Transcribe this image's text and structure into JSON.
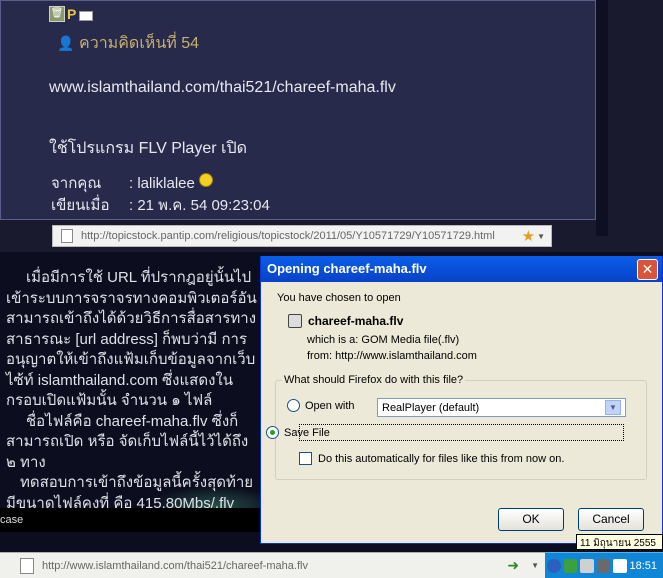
{
  "post": {
    "comment_label": "ความคิดเห็นที่ 54",
    "url": "www.islamthailand.com/thai521/chareef-maha.flv",
    "instruction": "ใช้โปรแกรม FLV Player เปิด",
    "from_key": "จากคุณ",
    "from_value": ": laliklalee",
    "date_key": "เขียนเมื่อ",
    "date_value": ": 21 พ.ค. 54 09:23:04"
  },
  "linkbar": {
    "url": "http://topicstock.pantip.com/religious/topicstock/2011/05/Y10571729/Y10571729.html"
  },
  "lower_text": {
    "paragraph1": "เมื่อมีการใช้ URL ที่ปรากฎอยู่นั้นไปเข้าระบบการจราจรทางคอมพิวเตอร์อันสามารถเข้าถึงได้ด้วยวิธีการสื่อสารทางสาธารณะ [url address] ก็พบว่ามี การอนุญาตให้เข้าถึงแฟ้มเก็บข้อมูลจากเว็บไซ้ท์ islamthailand.com ซึ่งแสดงในกรอบเปิดแฟ้มนั้น จำนวน ๑ ไฟล์",
    "paragraph2": "ชื่อไฟล์คือ chareef-maha.flv ซึ่งก็สามารถเปิด หรือ จัดเก็บไฟล์นี้ไว้ได้ถึง ๒ ทาง",
    "paragraph3": "ทดสอบการเข้าถึงข้อมูลนี้ครั้งสุดท้ายมีขนาดไฟล์คงที่ คือ 415.80Mbs/.flv",
    "video_caption": "case"
  },
  "dialog": {
    "title": "Opening chareef-maha.flv",
    "chosen_text": "You have chosen to open",
    "filename": "chareef-maha.flv",
    "which_is": "which is a:  GOM Media file(.flv)",
    "from": "from:  http://www.islamthailand.com",
    "question": "What should Firefox do with this file?",
    "open_with_label": "Open with",
    "open_with_value": "RealPlayer (default)",
    "save_label": "Save File",
    "auto_label": "Do this automatically for files like this from now on.",
    "ok_label": "OK",
    "cancel_label": "Cancel",
    "selected_option": "save"
  },
  "statusbar": {
    "url": "http://www.islamthailand.com/thai521/chareef-maha.flv"
  },
  "tray": {
    "time": "18:51",
    "date_tooltip": "11 มิถุนายน 2555"
  }
}
